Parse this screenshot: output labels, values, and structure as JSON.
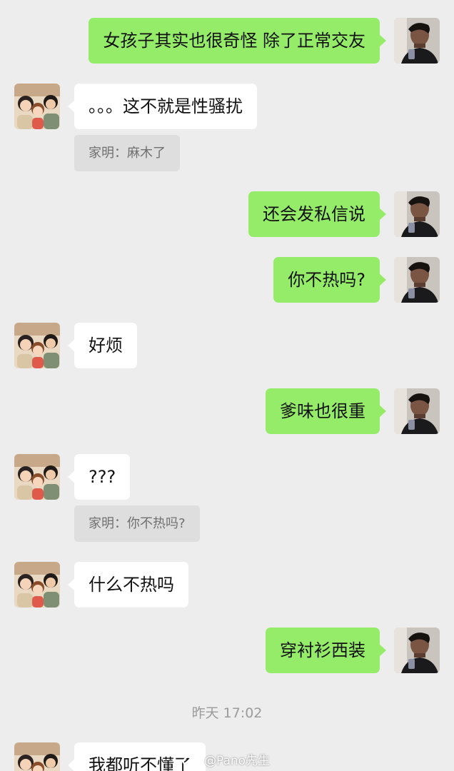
{
  "messages": [
    {
      "side": "out",
      "text": "女孩子其实也很奇怪 除了正常交友"
    },
    {
      "side": "in",
      "text": "。。。这不就是性骚扰",
      "quote": "家明：麻木了"
    },
    {
      "side": "out",
      "text": "还会发私信说"
    },
    {
      "side": "out",
      "text": "你不热吗?"
    },
    {
      "side": "in",
      "text": "好烦"
    },
    {
      "side": "out",
      "text": "爹味也很重"
    },
    {
      "side": "in",
      "text": "???",
      "quote": "家明：你不热吗?"
    },
    {
      "side": "in",
      "text": "什么不热吗"
    },
    {
      "side": "out",
      "text": "穿衬衫西装"
    },
    {
      "side": "in",
      "text": "我都听不懂了"
    }
  ],
  "timestamp": "昨天 17:02",
  "watermark": {
    "text": "@Pano先生",
    "icon": "weibo-logo-icon"
  },
  "avatars": {
    "self": "man-selfie-avatar-icon",
    "friend": "cartoon-family-avatar-icon"
  },
  "colors": {
    "background": "#ededed",
    "outgoing_bubble": "#95ec69",
    "incoming_bubble": "#ffffff",
    "quote_background": "#dedede"
  }
}
